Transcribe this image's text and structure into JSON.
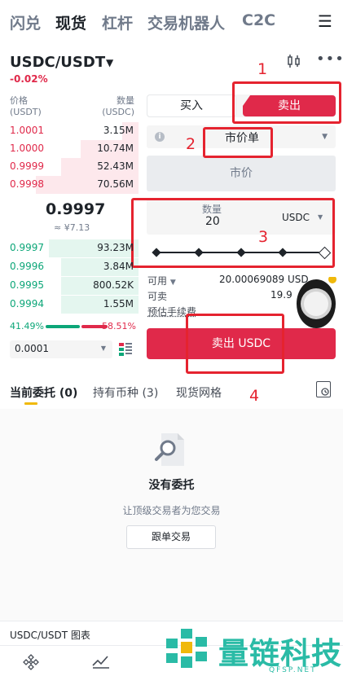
{
  "top_nav": {
    "items": [
      "闪兑",
      "现货",
      "杠杆",
      "交易机器人",
      "C2C"
    ],
    "active": "现货",
    "menu_icon": "hamburger-icon"
  },
  "pair": {
    "name": "USDC/USDT",
    "change": "-0.02%"
  },
  "order_book": {
    "header_price": "价格",
    "header_price_unit": "(USDT)",
    "header_qty": "数量",
    "header_qty_unit": "(USDC)",
    "asks": [
      {
        "price": "1.0001",
        "qty": "3.15M",
        "depth": 0.12
      },
      {
        "price": "1.0000",
        "qty": "10.74M",
        "depth": 0.42
      },
      {
        "price": "0.9999",
        "qty": "52.43M",
        "depth": 0.56
      },
      {
        "price": "0.9998",
        "qty": "70.56M",
        "depth": 0.74
      }
    ],
    "mid_price": "0.9997",
    "mid_cny": "≈ ¥7.13",
    "bids": [
      {
        "price": "0.9997",
        "qty": "93.23M",
        "depth": 0.65
      },
      {
        "price": "0.9996",
        "qty": "3.84M",
        "depth": 0.56
      },
      {
        "price": "0.9995",
        "qty": "800.52K",
        "depth": 0.56
      },
      {
        "price": "0.9994",
        "qty": "1.55M",
        "depth": 0.56
      }
    ],
    "buy_ratio": "41.49%",
    "sell_ratio": "58.51%",
    "precision": "0.0001"
  },
  "trade_form": {
    "buy_tab": "买入",
    "sell_tab": "卖出",
    "order_type": "市价单",
    "market_price": "市价",
    "qty_label": "数量",
    "qty_value": "20",
    "qty_unit": "USDC",
    "available_label": "可用",
    "available_value": "20.00069089 USD",
    "can_sell_label": "可卖",
    "can_sell_value": "19.9",
    "fee_label": "预估手续费",
    "submit": "卖出 USDC"
  },
  "bottom_tabs": {
    "open_orders": "当前委托",
    "open_orders_count": "(0)",
    "holdings": "持有币种",
    "holdings_count": "(3)",
    "grid": "现货网格"
  },
  "empty_state": {
    "title": "没有委托",
    "subtitle": "让顶级交易者为您交易",
    "button": "跟单交易"
  },
  "chart_bar": {
    "label": "USDC/USDT 图表"
  },
  "annotations": [
    "1",
    "2",
    "3",
    "4"
  ],
  "watermark": {
    "text": "量链科技",
    "sub": "QFSP.NET"
  },
  "colors": {
    "sell": "#e0294a",
    "buy": "#0ca678",
    "annotation": "#e5232f",
    "accent": "#f0b90b"
  }
}
